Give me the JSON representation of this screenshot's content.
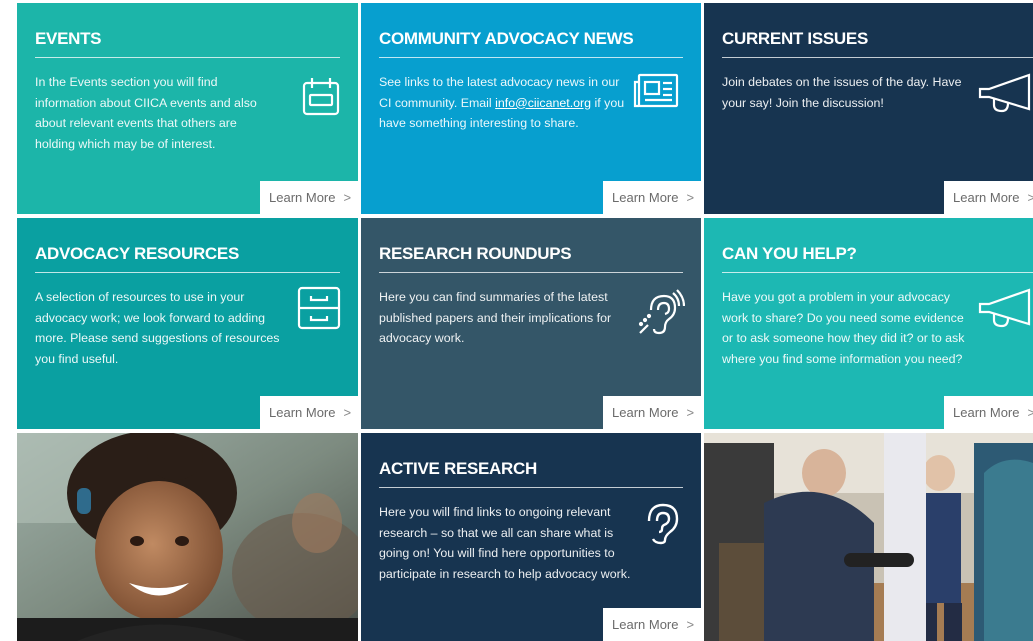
{
  "tiles": {
    "events": {
      "title": "EVENTS",
      "body": "In the Events section you will find information about CIICA events and also about relevant events that others are holding which may be of interest.",
      "link": "Learn More",
      "icon": "calendar-icon",
      "color": "#1cb5a9"
    },
    "news": {
      "title": "COMMUNITY ADVOCACY NEWS",
      "body_before": "See links to the latest advocacy news in our CI community. Email ",
      "email": "info@ciicanet.org",
      "body_after": " if you have something interesting to share.",
      "link": "Learn More",
      "icon": "newspaper-icon",
      "color": "#079fcf"
    },
    "issues": {
      "title": "CURRENT ISSUES",
      "body": "Join debates on the issues of the day. Have your say! Join the discussion!",
      "link": "Learn More",
      "icon": "megaphone-icon",
      "color": "#173450"
    },
    "resources": {
      "title": "ADVOCACY RESOURCES",
      "body": "A selection of resources to use in your advocacy work; we look forward to adding more. Please send suggestions of resources you find useful.",
      "link": "Learn More",
      "icon": "filing-cabinet-icon",
      "color": "#0aa0a1"
    },
    "roundups": {
      "title": "RESEARCH ROUNDUPS",
      "body": "Here you can find summaries of the latest published papers and their implications for advocacy work.",
      "link": "Learn More",
      "icon": "hearing-icon",
      "color": "#345668"
    },
    "help": {
      "title": "CAN YOU HELP?",
      "body": "Have you got a problem in your advocacy work to share? Do you need some evidence or to ask someone how they did it? or to ask where you find some information you need?",
      "link": "Learn More",
      "icon": "megaphone-icon",
      "color": "#1db8b3"
    },
    "active": {
      "title": "ACTIVE RESEARCH",
      "body": "Here you will find links to ongoing relevant research – so that we all can share what is going on! You will find here opportunities to participate in research to help advocacy work.",
      "link": "Learn More",
      "icon": "ear-icon",
      "color": "#173450"
    }
  },
  "photos": {
    "girl": "girl-with-cochlear-implant-photo",
    "press": "boy-interviewed-by-press-photo"
  }
}
